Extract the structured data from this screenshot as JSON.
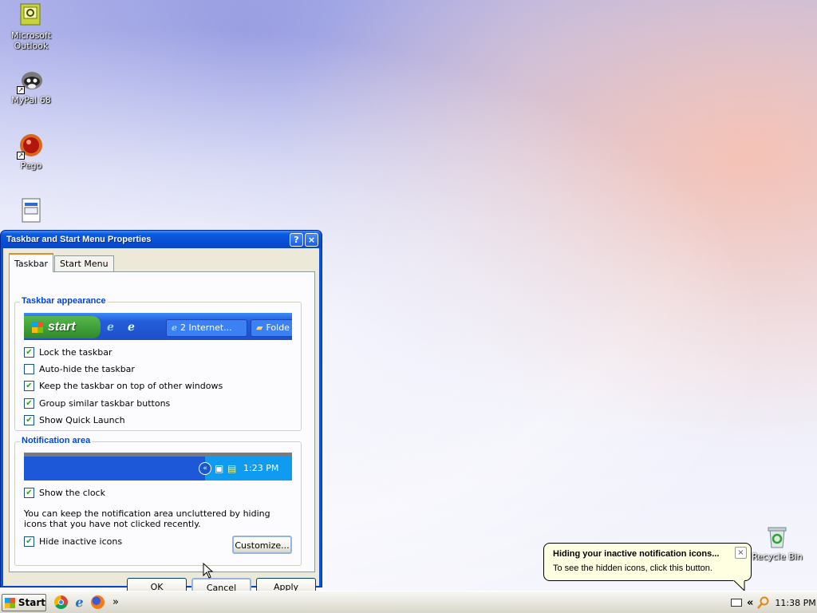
{
  "desktop": {
    "icons": [
      {
        "label": "Microsoft Outlook",
        "icon": "outlook-icon"
      },
      {
        "label": "MyPal 68",
        "icon": "raccoon-icon"
      },
      {
        "label": "Pego",
        "icon": "pego-icon"
      },
      {
        "label": "",
        "icon": "window-document-icon"
      },
      {
        "label": "Recycle Bin",
        "icon": "recycle-bin-icon"
      }
    ]
  },
  "dialog": {
    "title": "Taskbar and Start Menu Properties",
    "help_glyph": "?",
    "close_glyph": "×",
    "tabs": [
      "Taskbar",
      "Start Menu"
    ],
    "appearance": {
      "title": "Taskbar appearance",
      "preview_start": "start",
      "preview_button1": "2 Internet...",
      "preview_button2": "Folde",
      "options": [
        {
          "label": "Lock the taskbar",
          "checked": true
        },
        {
          "label": "Auto-hide the taskbar",
          "checked": false
        },
        {
          "label": "Keep the taskbar on top of other windows",
          "checked": true
        },
        {
          "label": "Group similar taskbar buttons",
          "checked": true
        },
        {
          "label": "Show Quick Launch",
          "checked": true
        }
      ]
    },
    "notification": {
      "title": "Notification area",
      "preview_time": "1:23 PM",
      "show_clock": {
        "label": "Show the clock",
        "checked": true
      },
      "description": "You can keep the notification area uncluttered by hiding icons that you have not clicked recently.",
      "hide_inactive": {
        "label": "Hide inactive icons",
        "checked": true
      },
      "customize_label": "Customize..."
    },
    "buttons": {
      "ok": "OK",
      "cancel": "Cancel",
      "apply": "Apply"
    }
  },
  "taskbar": {
    "start_label": "Start",
    "quick_launch": [
      "chrome-icon",
      "ie-icon",
      "firefox-icon"
    ],
    "overflow_glyph": "»",
    "tray_expand_glyph": "«",
    "clock": "11:38 PM"
  },
  "balloon": {
    "title": "Hiding your inactive notification icons...",
    "text": "To see the hidden icons, click this button.",
    "close_glyph": "×"
  }
}
